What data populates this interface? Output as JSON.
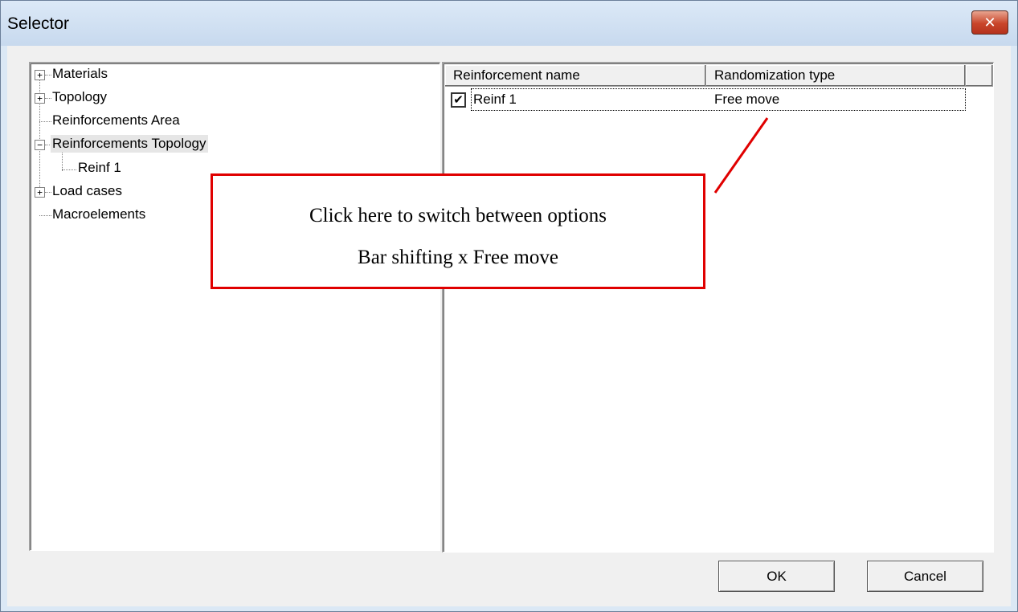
{
  "window": {
    "title": "Selector",
    "close_glyph": "✕"
  },
  "tree": {
    "items": [
      {
        "label": "Materials",
        "expander": "+"
      },
      {
        "label": "Topology",
        "expander": "+"
      },
      {
        "label": "Reinforcements Area",
        "expander": ""
      },
      {
        "label": "Reinforcements Topology",
        "expander": "−",
        "selected": true
      },
      {
        "label": "Reinf 1",
        "expander": "",
        "child": true
      },
      {
        "label": "Load cases",
        "expander": "+"
      },
      {
        "label": "Macroelements",
        "expander": ""
      }
    ]
  },
  "list": {
    "columns": [
      "Reinforcement name",
      "Randomization type"
    ],
    "rows": [
      {
        "checked": true,
        "check_glyph": "✔",
        "name": "Reinf 1",
        "type": "Free move"
      }
    ]
  },
  "buttons": {
    "ok": "OK",
    "cancel": "Cancel"
  },
  "callout": {
    "line1": "Click here to switch between options",
    "line2": "Bar shifting x Free move",
    "color": "#e00000"
  }
}
